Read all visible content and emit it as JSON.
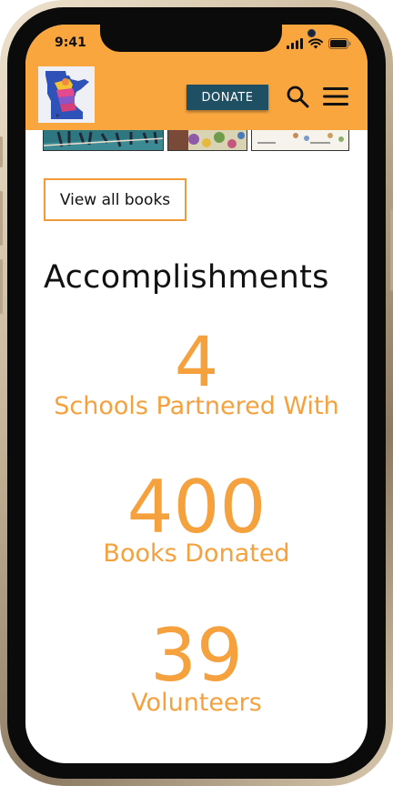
{
  "status_bar": {
    "time": "9:41"
  },
  "header": {
    "logo_icon": "minnesota-map-logo",
    "donate_label": "DONATE",
    "search_icon": "search-icon",
    "menu_icon": "hamburger-menu-icon",
    "background_color": "#f9a63f",
    "donate_color": "#1f4f63"
  },
  "books": {
    "view_all_label": "View all books"
  },
  "accomplishments": {
    "title": "Accomplishments",
    "stats": [
      {
        "value": "4",
        "label": "Schools Partnered With"
      },
      {
        "value": "400",
        "label": "Books Donated"
      },
      {
        "value": "39",
        "label": "Volunteers"
      }
    ],
    "accent_color": "#f4a13e"
  }
}
